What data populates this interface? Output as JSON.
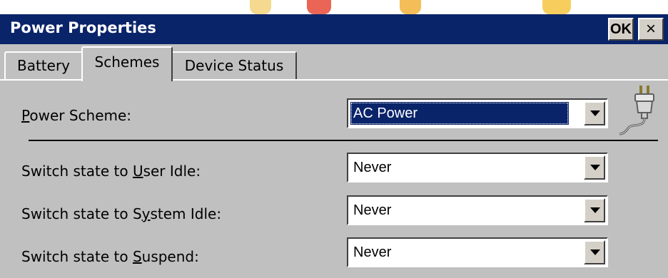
{
  "window": {
    "title": "Power Properties",
    "ok_label": "OK",
    "close_label": "×"
  },
  "tabs": [
    {
      "label": "Battery",
      "active": false
    },
    {
      "label": "Schemes",
      "active": true
    },
    {
      "label": "Device Status",
      "active": false
    }
  ],
  "power_scheme": {
    "label_mnemonic": "P",
    "label_rest": "ower Scheme:",
    "value": "AC Power",
    "icon": "power-plug-icon"
  },
  "settings": [
    {
      "label_before": "Switch state to ",
      "mnemonic": "U",
      "label_after": "ser Idle:",
      "value": "Never"
    },
    {
      "label_before": "Switch state to S",
      "mnemonic": "y",
      "label_after": "stem Idle:",
      "value": "Never"
    },
    {
      "label_before": "Switch state to ",
      "mnemonic": "S",
      "label_after": "uspend:",
      "value": "Never"
    }
  ],
  "colors": {
    "title_bar": "#0a246a",
    "face": "#c0c0c0",
    "selection": "#0a246a"
  }
}
